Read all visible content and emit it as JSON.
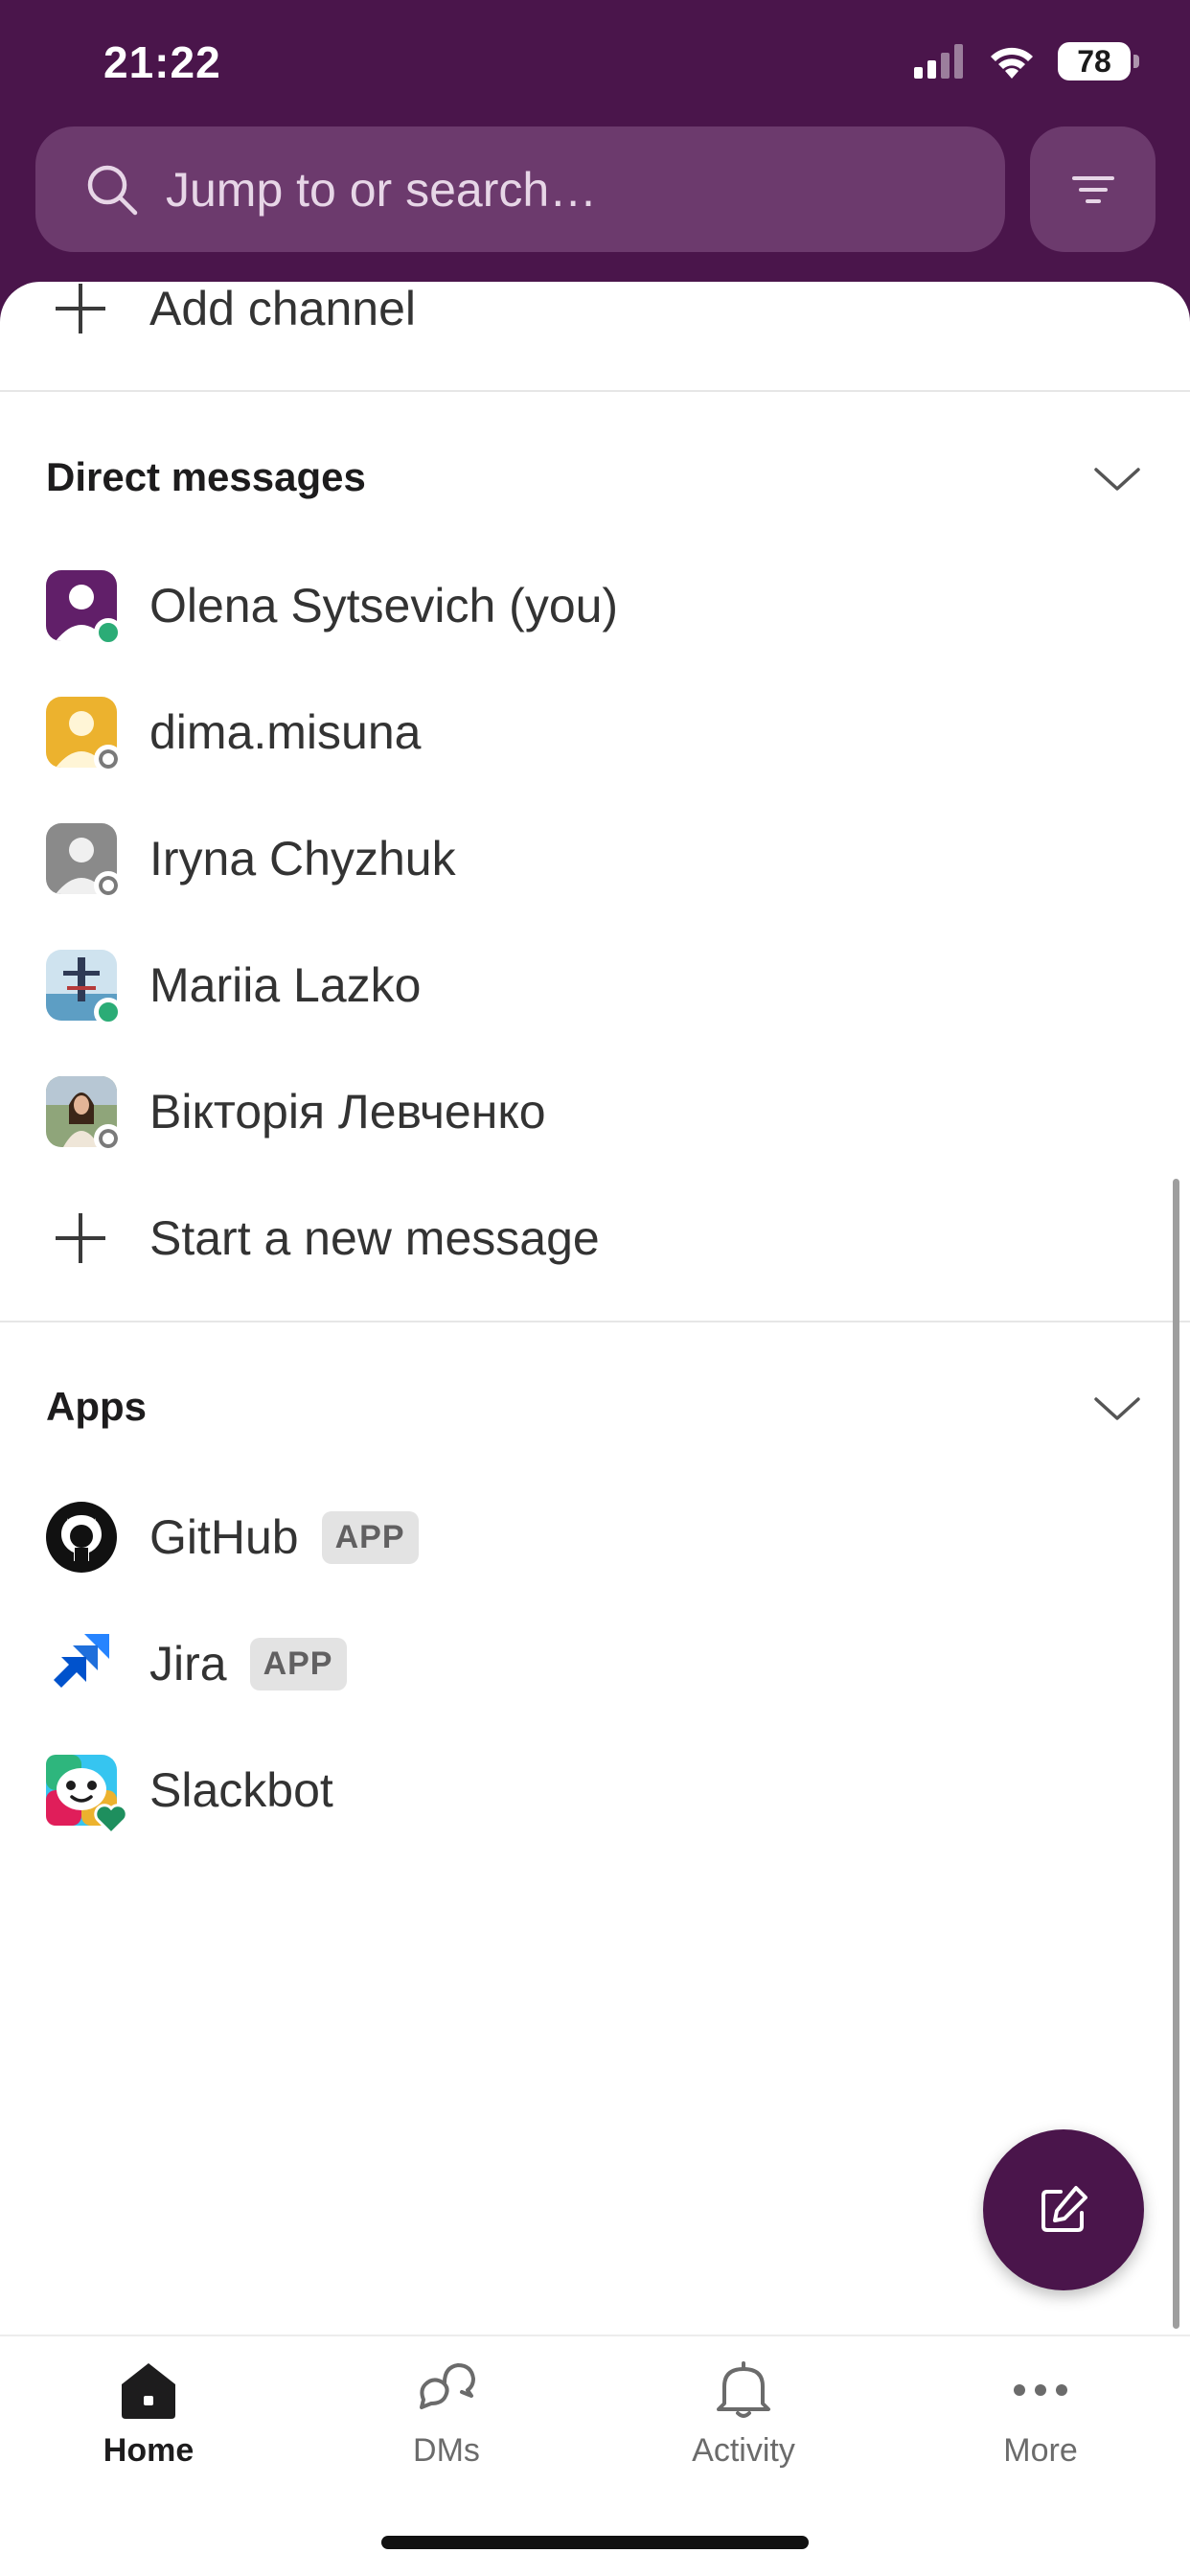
{
  "status_bar": {
    "time": "21:22",
    "battery": "78"
  },
  "search": {
    "placeholder": "Jump to or search…"
  },
  "channels": {
    "add_label": "Add channel"
  },
  "direct_messages": {
    "title": "Direct messages",
    "items": [
      {
        "name": "Olena Sytsevich (you)",
        "presence": "online",
        "avatar": "purple-default"
      },
      {
        "name": "dima.misuna",
        "presence": "away",
        "avatar": "yellow-default"
      },
      {
        "name": "Iryna Chyzhuk",
        "presence": "away",
        "avatar": "gray-default"
      },
      {
        "name": "Mariia Lazko",
        "presence": "online",
        "avatar": "photo-tower"
      },
      {
        "name": "Вікторія Левченко",
        "presence": "away",
        "avatar": "photo-person"
      }
    ],
    "new_message_label": "Start a new message"
  },
  "apps": {
    "title": "Apps",
    "items": [
      {
        "name": "GitHub",
        "badge": "APP",
        "icon": "github-icon"
      },
      {
        "name": "Jira",
        "badge": "APP",
        "icon": "jira-icon"
      },
      {
        "name": "Slackbot",
        "icon": "slackbot-icon"
      }
    ]
  },
  "tabs": [
    {
      "label": "Home",
      "icon": "home-icon",
      "active": true
    },
    {
      "label": "DMs",
      "icon": "dms-icon"
    },
    {
      "label": "Activity",
      "icon": "bell-icon"
    },
    {
      "label": "More",
      "icon": "more-icon"
    }
  ],
  "colors": {
    "brand": "#4a154b",
    "online": "#2bac76"
  }
}
